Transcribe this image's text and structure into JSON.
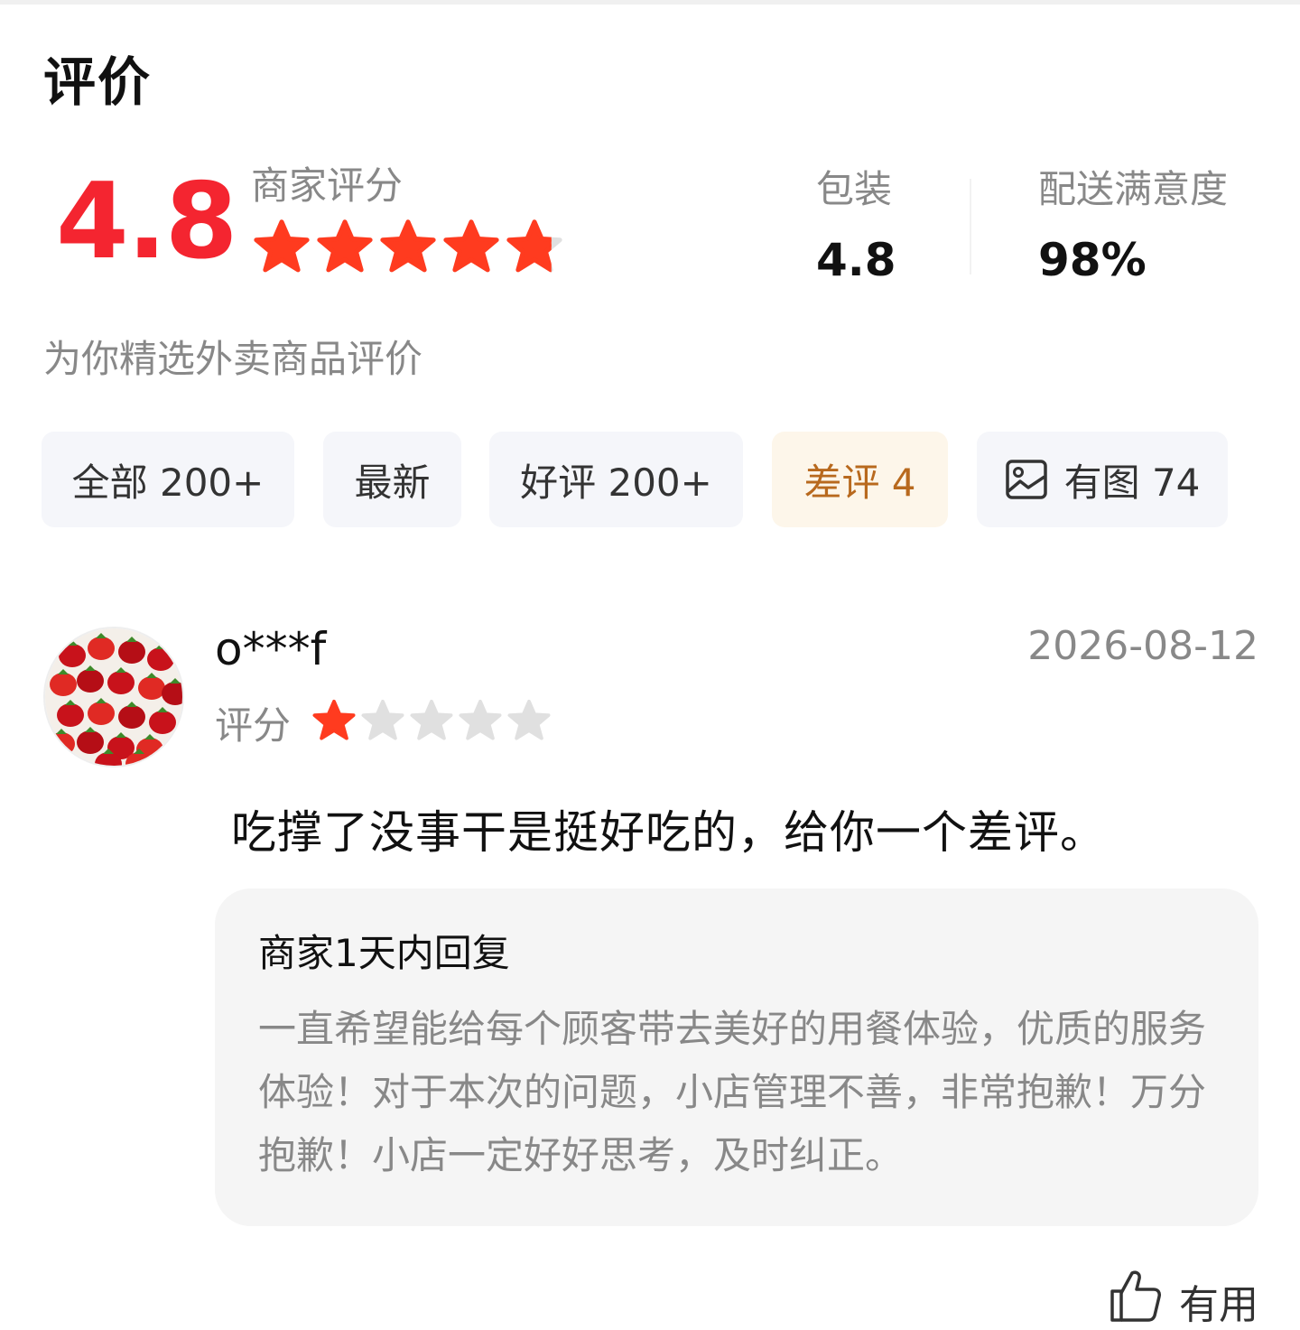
{
  "header": {
    "title": "评价"
  },
  "summary": {
    "score": "4.8",
    "merchant_label": "商家评分",
    "merchant_stars": 4.8,
    "metrics": [
      {
        "label": "包装",
        "value": "4.8"
      },
      {
        "label": "配送满意度",
        "value": "98%"
      }
    ]
  },
  "subtitle": "为你精选外卖商品评价",
  "filters": [
    {
      "label": "全部 200+"
    },
    {
      "label": "最新"
    },
    {
      "label": "好评 200+"
    },
    {
      "label": "差评 4",
      "active": true
    },
    {
      "label": "有图 74",
      "icon": "image-icon"
    }
  ],
  "review": {
    "username": "o***f",
    "date": "2026-08-12",
    "rating_label": "评分",
    "rating": 1,
    "comment": "吃撑了没事干是挺好吃的，给你一个差评。",
    "reply": {
      "title": "商家1天内回复",
      "body": "一直希望能给每个顾客带去美好的用餐体验，优质的服务体验！对于本次的问题，小店管理不善，非常抱歉！万分抱歉！小店一定好好思考，及时纠正。"
    },
    "useful_label": "有用"
  },
  "colors": {
    "accent_red": "#f42530",
    "star_red": "#ff3b1f",
    "star_gray": "#e0e0e0",
    "active_chip_bg": "#fdf6ea",
    "active_chip_text": "#b8691e"
  }
}
